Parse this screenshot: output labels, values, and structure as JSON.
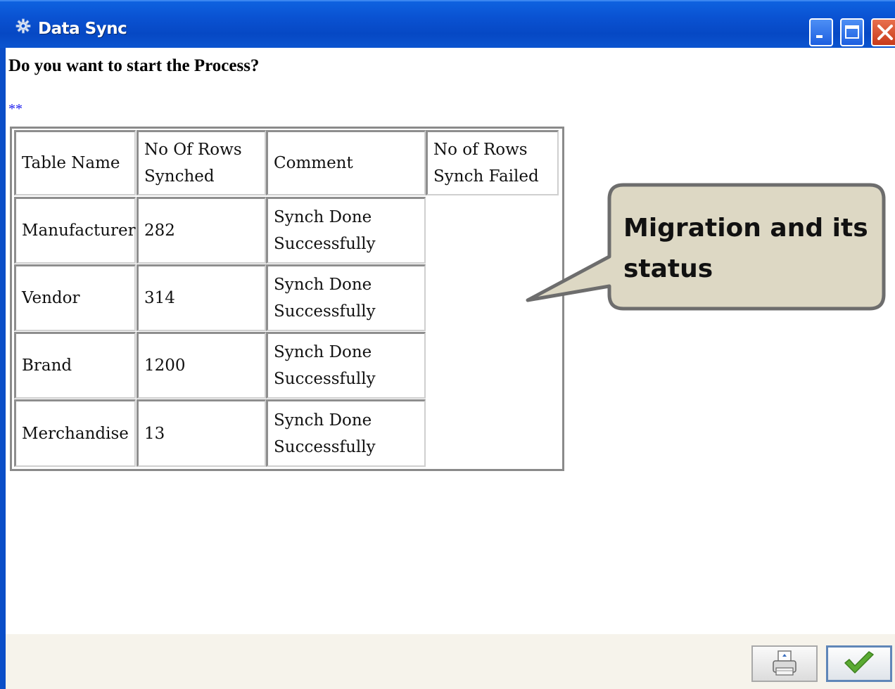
{
  "window": {
    "title": "Data Sync"
  },
  "content": {
    "question": "Do you want to start the Process?",
    "marker": "**"
  },
  "table": {
    "headers": [
      {
        "line1": "Table Name",
        "line2": ""
      },
      {
        "line1": "No Of Rows",
        "line2": "Synched"
      },
      {
        "line1": "Comment",
        "line2": ""
      },
      {
        "line1": "No of Rows",
        "line2": "Synch Failed"
      }
    ],
    "rows": [
      {
        "table_name": "Manufacturer",
        "rows_synched": "282",
        "comment_line1": "Synch Done",
        "comment_line2": "Successfully",
        "rows_failed": ""
      },
      {
        "table_name": "Vendor",
        "rows_synched": "314",
        "comment_line1": "Synch Done",
        "comment_line2": "Successfully",
        "rows_failed": ""
      },
      {
        "table_name": "Brand",
        "rows_synched": "1200",
        "comment_line1": "Synch Done",
        "comment_line2": "Successfully",
        "rows_failed": ""
      },
      {
        "table_name": "Merchandise",
        "rows_synched": "13",
        "comment_line1": "Synch Done",
        "comment_line2": "Successfully",
        "rows_failed": ""
      }
    ]
  },
  "callout": {
    "line1": "Migration and its",
    "line2": "status"
  },
  "icons": {
    "title": "gear-icon",
    "print": "printer-icon",
    "ok": "checkmark-icon",
    "minimize": "minimize-icon",
    "maximize": "maximize-icon",
    "close": "close-icon"
  },
  "colors": {
    "titlebar": "#0a52d2",
    "callout_fill": "#ddd8c4",
    "callout_border": "#6d6d6d",
    "marker": "#1a1aee",
    "checkmark": "#5aaa32"
  }
}
